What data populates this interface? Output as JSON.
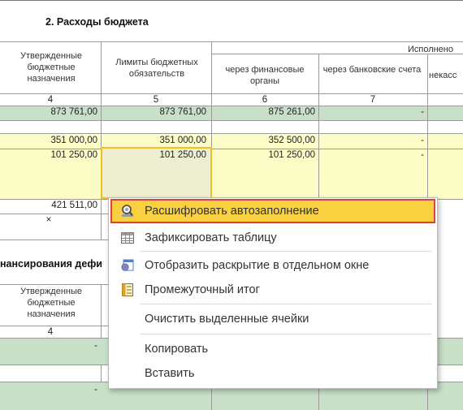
{
  "section_title": "2. Расходы бюджета",
  "section2_title": "нансирования дефи",
  "headers": {
    "col4": "Утвержденные бюджетные назначения",
    "col5": "Лимиты бюджетных обязательств",
    "executed": "Исполнено",
    "col6": "через финансовые органы",
    "col7": "через банковские счета",
    "col8": "некасс"
  },
  "col_numbers": [
    "4",
    "5",
    "6",
    "7"
  ],
  "rows": [
    {
      "c4": "873 761,00",
      "c5": "873 761,00",
      "c6": "875 261,00",
      "c7": "-"
    },
    {
      "c4": "351 000,00",
      "c5": "351 000,00",
      "c6": "352 500,00",
      "c7": "-"
    },
    {
      "c4": "101 250,00",
      "c5": "101 250,00",
      "c6": "101 250,00",
      "c7": "-"
    },
    {
      "c4": "421 511,00"
    },
    {
      "c4": "×"
    }
  ],
  "lower": {
    "col4": "Утвержденные бюджетные назначения",
    "col_number": "4",
    "dash": "-"
  },
  "menu": {
    "items": [
      {
        "label": "Расшифровать автозаполнение",
        "icon": "magnifier-icon"
      },
      {
        "label": "Зафиксировать таблицу",
        "icon": "table-grid-icon"
      },
      {
        "label": "Отобразить раскрытие в отдельном окне",
        "icon": "window-expand-icon"
      },
      {
        "label": "Промежуточный итог",
        "icon": "subtotal-icon"
      },
      {
        "label": "Очистить выделенные ячейки"
      },
      {
        "label": "Копировать"
      },
      {
        "label": "Вставить"
      }
    ]
  },
  "colors": {
    "row_green": "#c8e0c8",
    "row_yellow": "#fdfdc8",
    "menu_highlight": "#f8d040",
    "menu_highlight_border": "#d94040",
    "selection_border": "#f0c020"
  }
}
